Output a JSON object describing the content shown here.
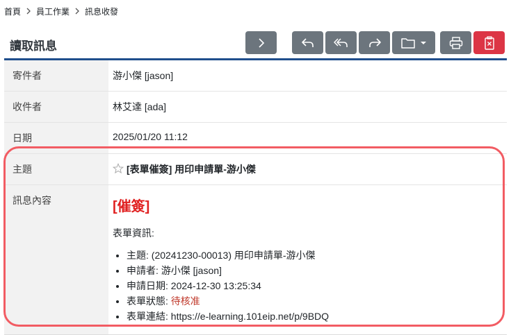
{
  "breadcrumb": {
    "items": [
      "首頁",
      "員工作業",
      "訊息收發"
    ]
  },
  "header": {
    "title": "讀取訊息"
  },
  "toolbar": {
    "icons": [
      "chevron-right-icon",
      "reply-icon",
      "reply-all-icon",
      "forward-icon",
      "folder-icon",
      "caret-down-icon",
      "print-icon",
      "delete-icon"
    ]
  },
  "message": {
    "sender_label": "寄件者",
    "sender_value": "游小傑 [jason]",
    "recipient_label": "收件者",
    "recipient_value": "林艾達 [ada]",
    "date_label": "日期",
    "date_value": "2025/01/20 11:12",
    "subject_label": "主題",
    "subject_value": "[表單催簽] 用印申請單-游小傑",
    "content_label": "訊息內容",
    "urgent_tag": "[催簽]",
    "info_heading": "表單資訊:",
    "info": {
      "subject": "主題: (20241230-00013) 用印申請單-游小傑",
      "applicant": "申請者: 游小傑 [jason]",
      "apply_date": "申請日期: 2024-12-30 13:25:34",
      "status_label": "表單狀態: ",
      "status_value": "待核准",
      "link": "表單連結: https://e-learning.101eip.net/p/9BDQ"
    }
  },
  "colors": {
    "header_rule": "#1f4e8c",
    "button_gray": "#6c757d",
    "button_danger": "#dc3545",
    "urgent": "#e02020",
    "status": "#c0392b",
    "highlight": "#f25c63"
  }
}
